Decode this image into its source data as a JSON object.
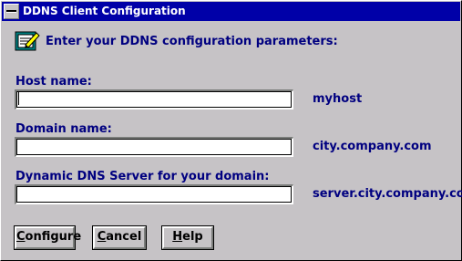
{
  "window": {
    "title": "DDNS Client Configuration"
  },
  "header": {
    "text": "Enter your DDNS configuration parameters:",
    "icon": "config-icon"
  },
  "fields": [
    {
      "label": "Host name:",
      "value": "",
      "example": "myhost"
    },
    {
      "label": "Domain name:",
      "value": "",
      "example": "city.company.com"
    },
    {
      "label": "Dynamic DNS Server for your domain:",
      "value": "",
      "example": "server.city.company.com"
    }
  ],
  "buttons": {
    "configure": {
      "first": "C",
      "rest": "onfigure"
    },
    "cancel": {
      "first": "C",
      "rest": "ancel"
    },
    "help": {
      "first": "H",
      "rest": "elp"
    }
  },
  "colors": {
    "title_bar": "#0000a8",
    "label_text": "#000080",
    "window_bg": "#c6c3c6"
  }
}
